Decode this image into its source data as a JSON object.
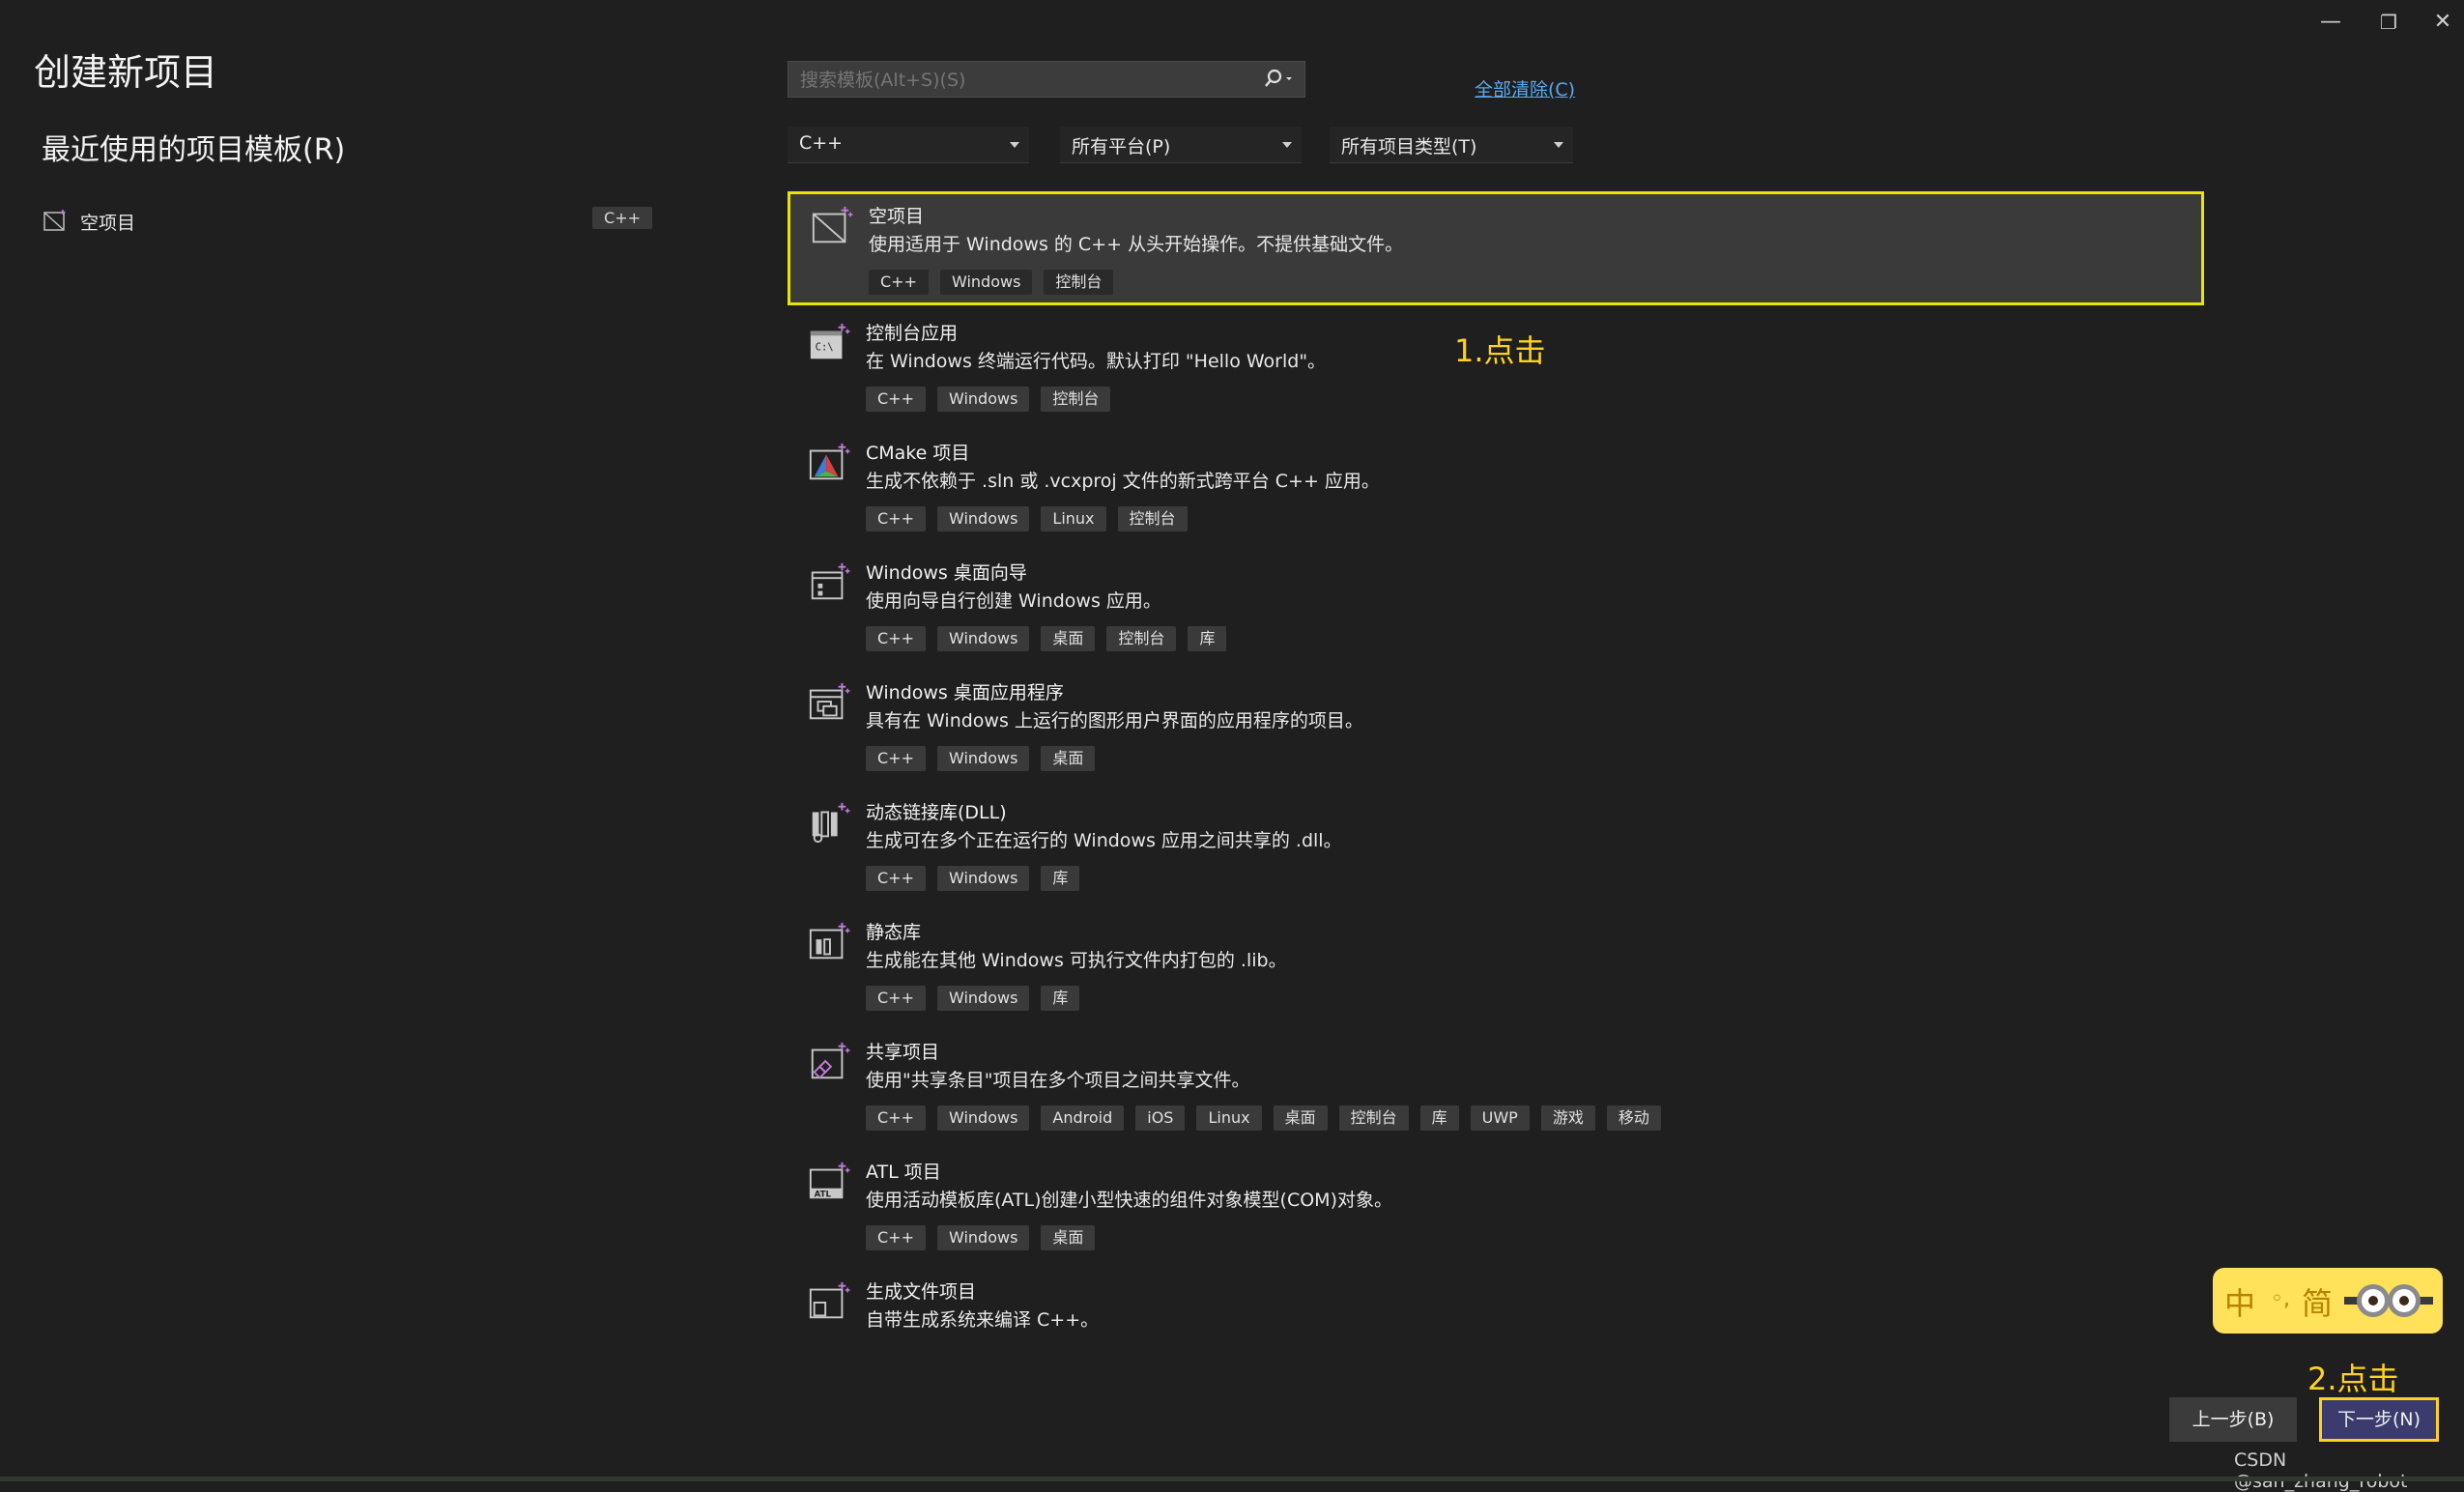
{
  "window_controls": {
    "minimize": "—",
    "restore": "❐",
    "close": "✕"
  },
  "page_title": "创建新项目",
  "recent": {
    "heading": "最近使用的项目模板(R)",
    "items": [
      {
        "label": "空项目",
        "lang": "C++"
      }
    ]
  },
  "search": {
    "placeholder": "搜索模板(Alt+S)(S)"
  },
  "clear_all": "全部清除(C)",
  "filters": {
    "language": "C++",
    "platform": "所有平台(P)",
    "project_type": "所有项目类型(T)"
  },
  "templates": [
    {
      "icon": "empty-project-icon",
      "name": "空项目",
      "desc": "使用适用于 Windows 的 C++ 从头开始操作。不提供基础文件。",
      "tags": [
        "C++",
        "Windows",
        "控制台"
      ],
      "selected": true
    },
    {
      "icon": "console-app-icon",
      "name": "控制台应用",
      "desc": "在 Windows 终端运行代码。默认打印 \"Hello World\"。",
      "tags": [
        "C++",
        "Windows",
        "控制台"
      ]
    },
    {
      "icon": "cmake-icon",
      "name": "CMake 项目",
      "desc": "生成不依赖于 .sln 或 .vcxproj 文件的新式跨平台 C++ 应用。",
      "tags": [
        "C++",
        "Windows",
        "Linux",
        "控制台"
      ]
    },
    {
      "icon": "desktop-wizard-icon",
      "name": "Windows 桌面向导",
      "desc": "使用向导自行创建 Windows 应用。",
      "tags": [
        "C++",
        "Windows",
        "桌面",
        "控制台",
        "库"
      ]
    },
    {
      "icon": "desktop-app-icon",
      "name": "Windows 桌面应用程序",
      "desc": "具有在 Windows 上运行的图形用户界面的应用程序的项目。",
      "tags": [
        "C++",
        "Windows",
        "桌面"
      ]
    },
    {
      "icon": "dll-icon",
      "name": "动态链接库(DLL)",
      "desc": "生成可在多个正在运行的 Windows 应用之间共享的 .dll。",
      "tags": [
        "C++",
        "Windows",
        "库"
      ]
    },
    {
      "icon": "static-lib-icon",
      "name": "静态库",
      "desc": "生成能在其他 Windows 可执行文件内打包的 .lib。",
      "tags": [
        "C++",
        "Windows",
        "库"
      ]
    },
    {
      "icon": "shared-project-icon",
      "name": "共享项目",
      "desc": "使用\"共享条目\"项目在多个项目之间共享文件。",
      "tags": [
        "C++",
        "Windows",
        "Android",
        "iOS",
        "Linux",
        "桌面",
        "控制台",
        "库",
        "UWP",
        "游戏",
        "移动"
      ]
    },
    {
      "icon": "atl-project-icon",
      "name": "ATL 项目",
      "desc": "使用活动模板库(ATL)创建小型快速的组件对象模型(COM)对象。",
      "tags": [
        "C++",
        "Windows",
        "桌面"
      ]
    },
    {
      "icon": "makefile-project-icon",
      "name": "生成文件项目",
      "desc": "自带生成系统来编译 C++。",
      "tags": []
    }
  ],
  "annotations": {
    "step1": "1.点击",
    "step2": "2.点击"
  },
  "ime": {
    "lang": "中",
    "mode": "简"
  },
  "buttons": {
    "back": "上一步(B)",
    "next": "下一步(N)"
  },
  "watermark": "CSDN @san_zhang_robot"
}
